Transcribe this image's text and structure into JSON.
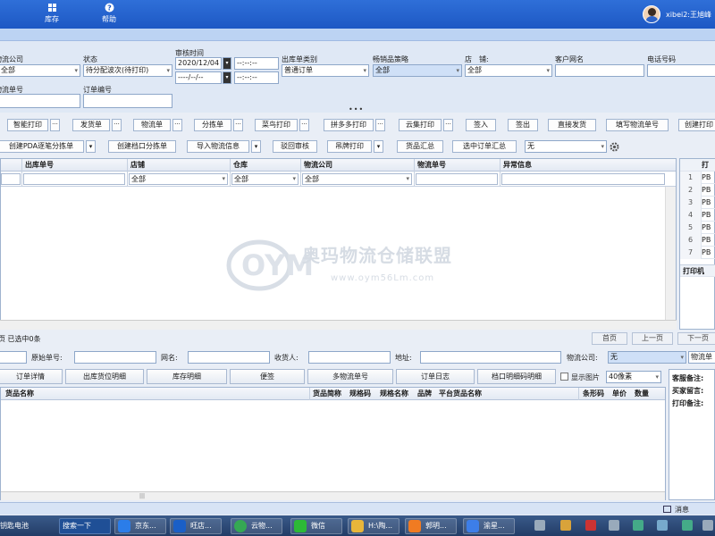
{
  "header": {
    "left_fragment": "出",
    "inventory_label": "库存",
    "help_label": "帮助",
    "user_label": "xibei2:王旭峰"
  },
  "filters": {
    "logistics_company_label": "物流公司",
    "logistics_company_value": "全部",
    "status_label": "状态",
    "status_value": "待分配波次(待打印)",
    "audit_time_label": "审核时间",
    "audit_date_from": "2020/12/04",
    "audit_time_from": "--:--:--",
    "audit_date_to": "----/--/--",
    "audit_time_to": "--:--:--",
    "outbound_type_label": "出库单类别",
    "outbound_type_value": "普通订单",
    "bestseller_label": "畅销品策略",
    "bestseller_value": "全部",
    "shop_label": "店　铺:",
    "shop_value": "全部",
    "customer_label": "客户网名",
    "phone_label": "电话号码",
    "logistics_no_label": "物流单号",
    "order_no_label": "订单编号",
    "collapse_dots": "•••"
  },
  "toolbar1": {
    "smart_print": "智能打印",
    "delivery_note": "发货单",
    "logistics_note": "物流单",
    "pick_list": "分拣单",
    "cainiao_print": "菜鸟打印",
    "pdd_print": "拼多多打印",
    "yunji_print": "云集打印",
    "sign_in": "签入",
    "sign_out": "签出",
    "direct_ship": "直接发货",
    "fill_logistics_no": "填写物流单号",
    "create_print": "创建打印",
    "dots": "···"
  },
  "toolbar2": {
    "create_pda_pick": "创建PDA逐笔分拣单",
    "create_stall_pick": "创建档口分拣单",
    "import_logistics": "导入物流信息",
    "reject_audit": "驳回审核",
    "hang_print": "吊牌打印",
    "goods_summary": "货品汇总",
    "selected_summary": "选中订单汇总",
    "select_value": "无",
    "arrow": "▾"
  },
  "grid": {
    "columns": [
      "出库单号",
      "店铺",
      "仓库",
      "物流公司",
      "物流单号",
      "异常信息"
    ],
    "filter_shop": "全部",
    "filter_warehouse": "全部",
    "filter_logistics": "全部"
  },
  "right_panel": {
    "header": "打",
    "rows": [
      {
        "n": "1",
        "v": "PB"
      },
      {
        "n": "2",
        "v": "PB"
      },
      {
        "n": "3",
        "v": "PB"
      },
      {
        "n": "4",
        "v": "PB"
      },
      {
        "n": "5",
        "v": "PB"
      },
      {
        "n": "6",
        "v": "PB"
      },
      {
        "n": "7",
        "v": "PB"
      }
    ],
    "printer_label": "打印机"
  },
  "watermark": {
    "brand": "奥玛物流仓储联盟",
    "url": "www.oym56Lm.com"
  },
  "status": {
    "left_text": "页  已选中0条",
    "first_page": "首页",
    "prev_page": "上一页",
    "next_page": "下一页"
  },
  "detail": {
    "original_no_label": "原始单号:",
    "nickname_label": "网名:",
    "receiver_label": "收货人:",
    "address_label": "地址:",
    "logistics_label": "物流公司:",
    "logistics_value": "无",
    "logistics_no_label": "物流单"
  },
  "tabs": {
    "order_detail": "订单详情",
    "outbound_position": "出库货位明细",
    "stock_detail": "库存明细",
    "note": "便签",
    "multi_logistics": "多物流单号",
    "order_log": "订单日志",
    "stall_detail": "档口明细码明细",
    "show_image": "显示图片",
    "pixel_value": "40像素"
  },
  "lower_grid": {
    "goods_name": "货品名称",
    "goods_short": "货品简称",
    "spec_code": "规格码",
    "spec_name": "规格名称",
    "brand": "品牌",
    "platform_goods": "平台货品名称",
    "barcode": "条形码",
    "unit_price": "单价",
    "quantity": "数量"
  },
  "notes": {
    "service_note": "客服备注:",
    "buyer_msg": "买家留言:",
    "print_note": "打印备注:"
  },
  "msgbar": {
    "message": "消息"
  },
  "taskbar": {
    "item1": "钥匙电池",
    "item2": "搜索一下",
    "item3": "京东...",
    "item4": "旺店...",
    "item5": "云物...",
    "item6": "微信",
    "item7": "H:\\陶...",
    "item8": "郭明...",
    "item9": "渝星..."
  }
}
